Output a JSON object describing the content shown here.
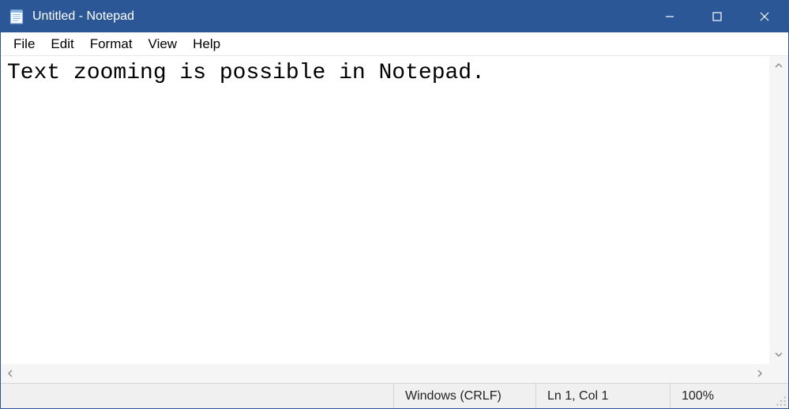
{
  "window": {
    "title": "Untitled - Notepad"
  },
  "menu": {
    "items": [
      "File",
      "Edit",
      "Format",
      "View",
      "Help"
    ]
  },
  "editor": {
    "content": "Text zooming is possible in Notepad."
  },
  "status": {
    "eol": "Windows (CRLF)",
    "cursor": "Ln 1, Col 1",
    "zoom": "100%"
  }
}
